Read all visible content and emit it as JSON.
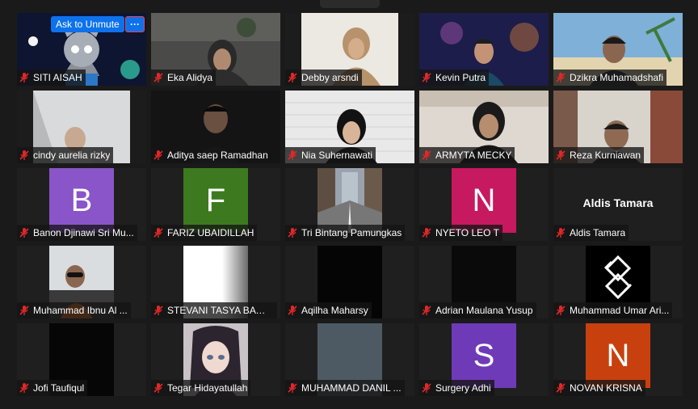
{
  "overlay": {
    "ask_to_unmute": "Ask to Unmute",
    "more": "···"
  },
  "participants": [
    {
      "name": "SITI AISAH"
    },
    {
      "name": "Eka Alidya"
    },
    {
      "name": "Debby arsndi"
    },
    {
      "name": "Kevin Putra"
    },
    {
      "name": "Dzikra Muhamadshafi"
    },
    {
      "name": "cindy aurelia rizky"
    },
    {
      "name": "Aditya saep Ramadhan"
    },
    {
      "name": "Nia Suhernawati"
    },
    {
      "name": "ARMYTA MECKY"
    },
    {
      "name": "Reza Kurniawan"
    },
    {
      "name": "Banon Djinawi Sri Mu...",
      "initial": "B",
      "color": "#8a55c8"
    },
    {
      "name": "FARIZ UBAIDILLAH",
      "initial": "F",
      "color": "#3d7a1f"
    },
    {
      "name": "Tri Bintang Pamungkas"
    },
    {
      "name": "NYETO LEO T",
      "initial": "N",
      "color": "#c7195f"
    },
    {
      "name": "Aldis Tamara",
      "display": "Aldis Tamara"
    },
    {
      "name": "Muhammad Ibnu Al ..."
    },
    {
      "name": "STEVANI TASYA BAWA..."
    },
    {
      "name": "Aqilha Maharsy"
    },
    {
      "name": "Adrian Maulana Yusup"
    },
    {
      "name": "Muhammad Umar Ari..."
    },
    {
      "name": "Jofi Taufiqul"
    },
    {
      "name": "Tegar Hidayatullah"
    },
    {
      "name": "MUHAMMAD DANIL ..."
    },
    {
      "name": "Surgery Adhi",
      "initial": "S",
      "color": "#6f3ab8"
    },
    {
      "name": "NOVAN KRISNA",
      "initial": "N",
      "color": "#c9400f"
    }
  ],
  "colors": {
    "muted_mic": "#e02828",
    "accent": "#0e72ed"
  }
}
